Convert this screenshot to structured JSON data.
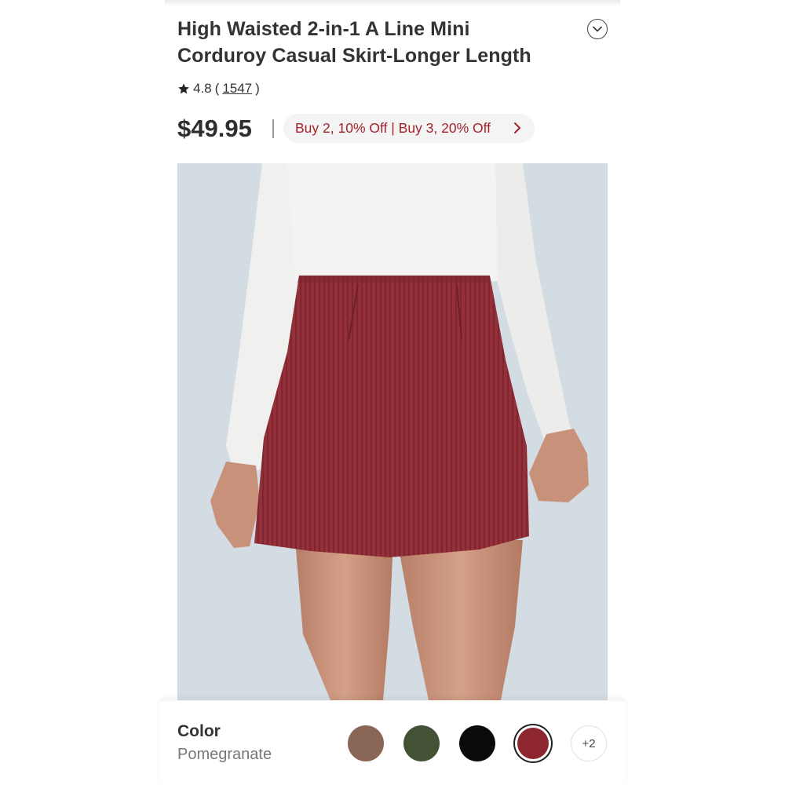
{
  "product": {
    "title_line1": "High Waisted 2-in-1 A Line Mini",
    "title_line2": "Corduroy Casual Skirt-Longer Length",
    "rating": "4.8",
    "review_count": "1547",
    "price": "$49.95",
    "promo": "Buy 2, 10% Off | Buy 3, 20% Off"
  },
  "icons": {
    "collapse": "chevron-down-icon",
    "rating": "star-icon",
    "promo": "chevron-right-icon"
  },
  "color": {
    "label": "Color",
    "selected": "Pomegranate",
    "swatches": [
      {
        "name": "brown",
        "hex": "#8a6656"
      },
      {
        "name": "olive",
        "hex": "#435235"
      },
      {
        "name": "black",
        "hex": "#0b0b0b"
      },
      {
        "name": "pomegranate",
        "hex": "#8e2630"
      }
    ],
    "more_label": "+2"
  },
  "colors": {
    "promo_text": "#a2232c",
    "skirt": "#93303a",
    "background": "#d3dce3"
  }
}
